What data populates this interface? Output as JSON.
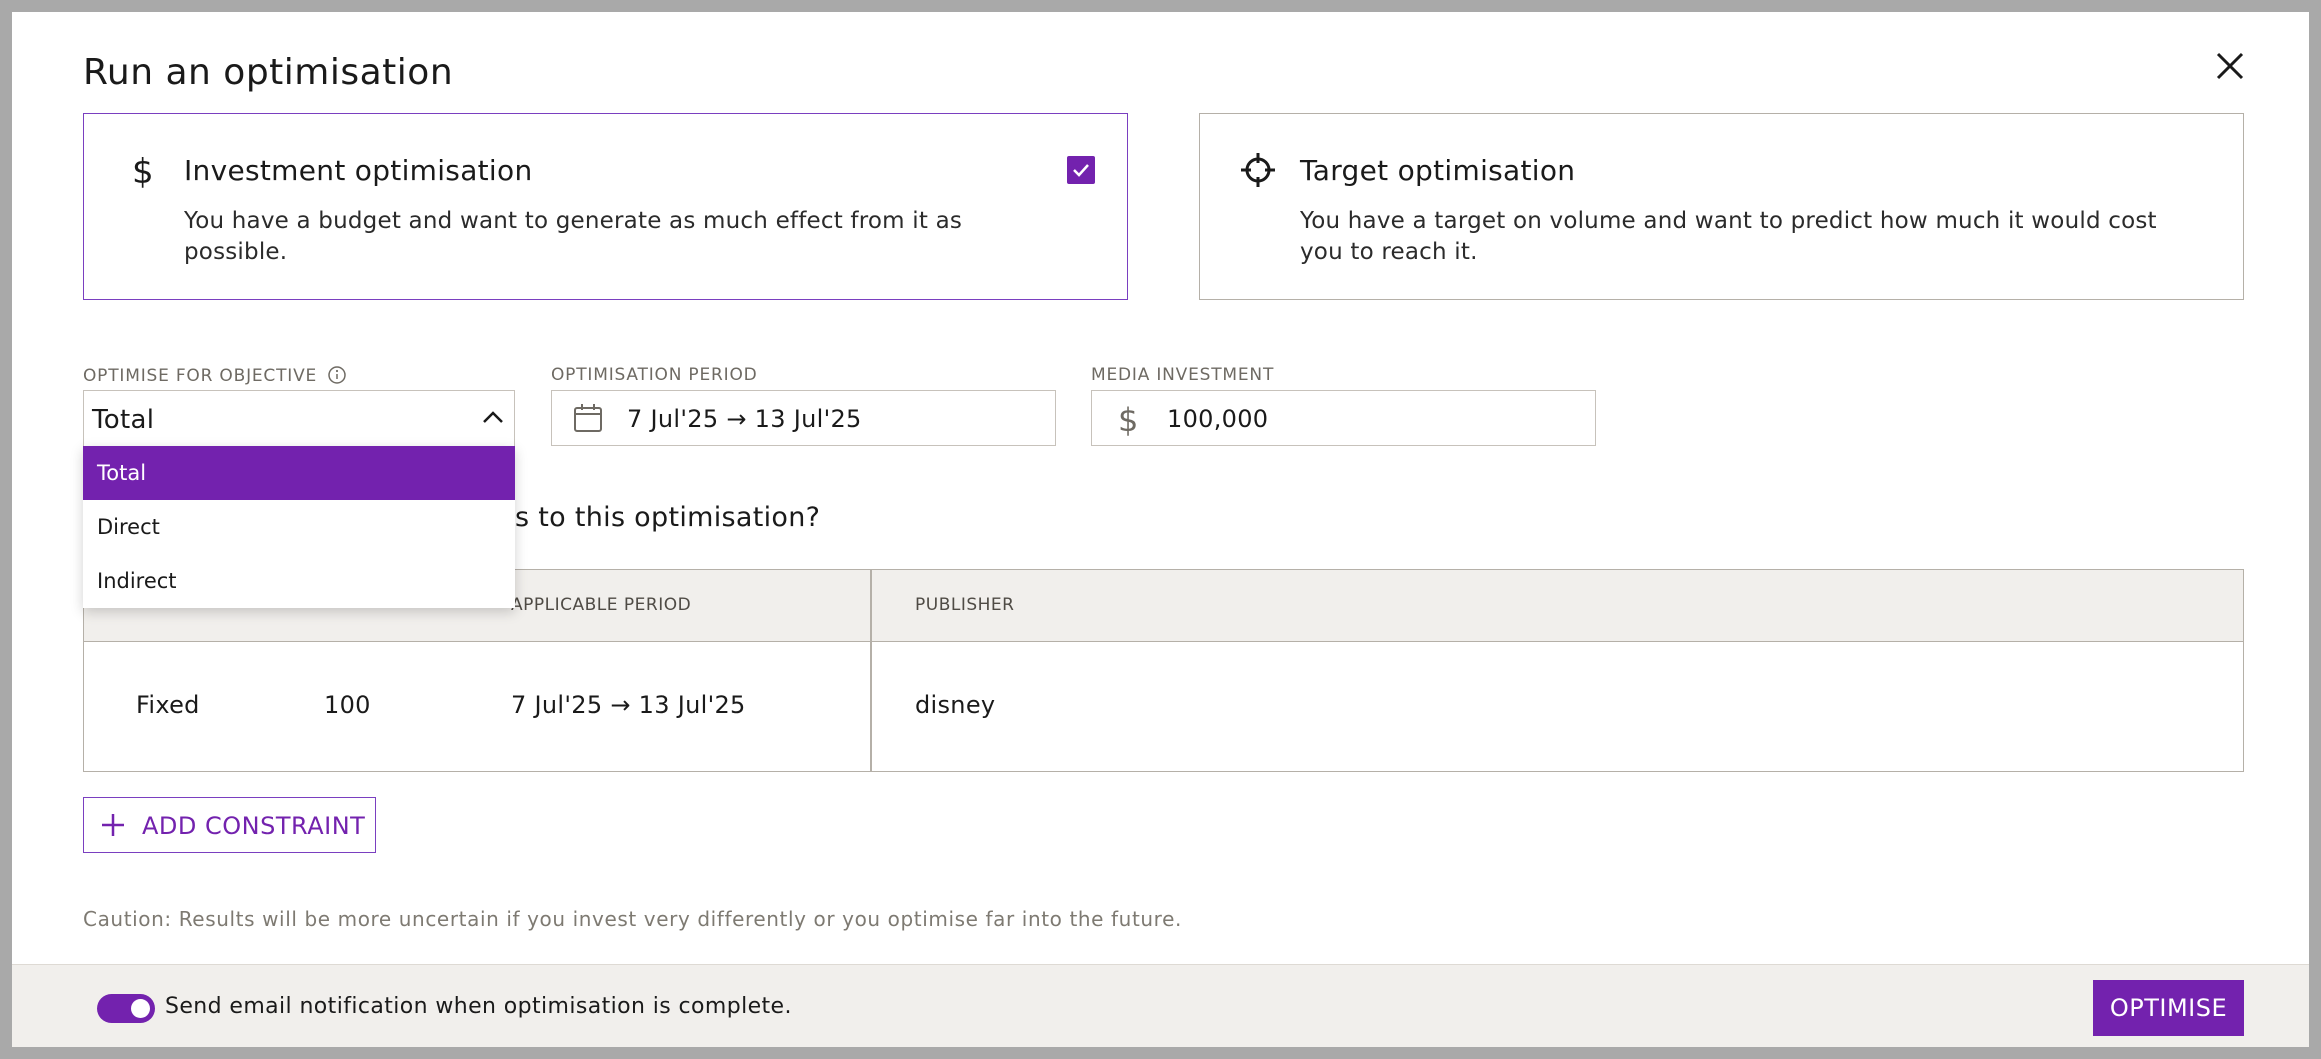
{
  "dialog": {
    "title": "Run an optimisation"
  },
  "cards": {
    "investment": {
      "title": "Investment optimisation",
      "description": "You have a budget and want to generate as much effect from it as possible.",
      "selected": true
    },
    "target": {
      "title": "Target optimisation",
      "description": "You have a target on volume and want to predict how much it would cost you to reach it."
    }
  },
  "fields": {
    "objective": {
      "label": "OPTIMISE FOR OBJECTIVE",
      "value": "Total",
      "options": [
        "Total",
        "Direct",
        "Indirect"
      ]
    },
    "period": {
      "label": "OPTIMISATION PERIOD",
      "value": "7 Jul'25 → 13 Jul'25"
    },
    "investment": {
      "label": "MEDIA INVESTMENT",
      "value": "100,000"
    }
  },
  "constraints": {
    "question_visible": "s to this optimisation?",
    "headers": {
      "period": "APPLICABLE PERIOD",
      "publisher": "PUBLISHER"
    },
    "rows": [
      {
        "type": "Fixed",
        "amount": "100",
        "period": "7 Jul'25 → 13 Jul'25",
        "publisher": "disney"
      }
    ],
    "add_label": "ADD CONSTRAINT"
  },
  "caution": "Caution: Results will be more uncertain if you invest very differently or you optimise far into the future.",
  "footer": {
    "notification_text": "Send email notification when optimisation is complete.",
    "notification_on": true,
    "optimise_label": "OPTIMISE"
  },
  "colors": {
    "accent": "#7322ae",
    "border": "#b5b0a8",
    "header_bg": "#f1efec"
  }
}
